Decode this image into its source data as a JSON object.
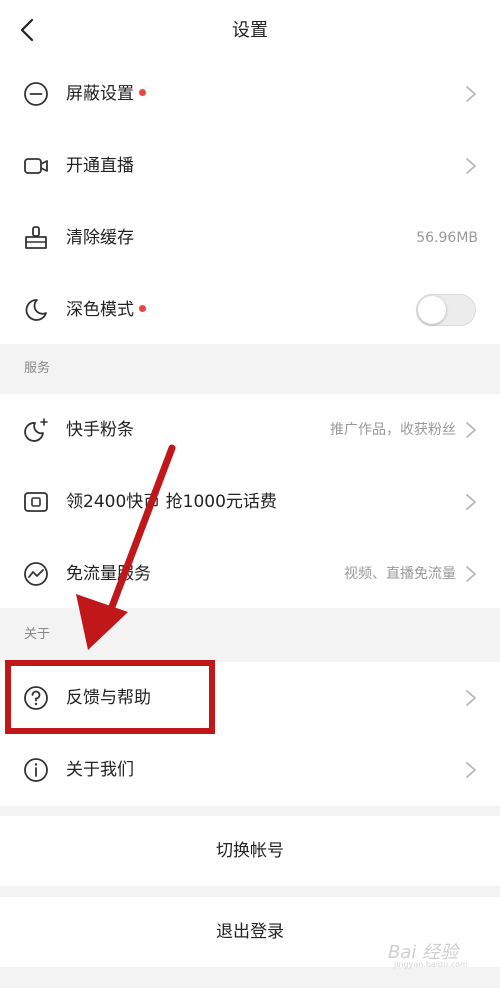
{
  "header": {
    "title": "设置",
    "back_icon": "chevron-left-icon"
  },
  "group1": {
    "items": [
      {
        "label": "屏蔽设置",
        "icon": "minus-circle-icon",
        "has_dot": true,
        "value": ""
      },
      {
        "label": "开通直播",
        "icon": "video-camera-icon",
        "has_dot": false,
        "value": ""
      },
      {
        "label": "清除缓存",
        "icon": "brush-icon",
        "has_dot": false,
        "value": "56.96MB"
      },
      {
        "label": "深色模式",
        "icon": "moon-icon",
        "has_dot": true,
        "value": "",
        "toggle_on": false
      }
    ]
  },
  "services": {
    "section_title": "服务",
    "items": [
      {
        "label": "快手粉条",
        "icon": "sparkle-icon",
        "value": "推广作品，收获粉丝"
      },
      {
        "label": "领2400快币 抢1000元话费",
        "icon": "coin-card-icon",
        "value": ""
      },
      {
        "label": "免流量服务",
        "icon": "trend-line-icon",
        "value": "视频、直播免流量"
      }
    ]
  },
  "about": {
    "section_title": "关于",
    "items": [
      {
        "label": "反馈与帮助",
        "icon": "question-circle-icon",
        "value": ""
      },
      {
        "label": "关于我们",
        "icon": "info-circle-icon",
        "value": ""
      }
    ]
  },
  "actions": {
    "switch_account": "切换帐号",
    "logout": "退出登录"
  },
  "colors": {
    "accent_dot": "#e8453c",
    "annotation": "#c0171b",
    "background": "#f3f3f3"
  },
  "watermark": {
    "text": "Bai 经验",
    "sub": "jingyan.baidu.com"
  }
}
